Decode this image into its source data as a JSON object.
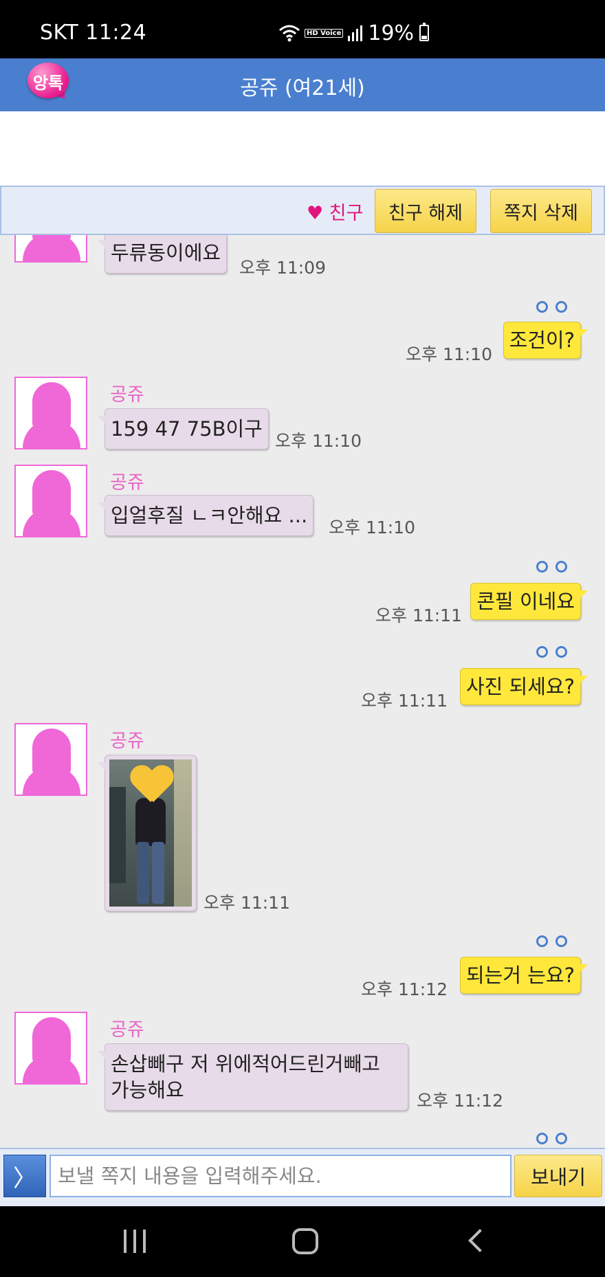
{
  "status_bar": {
    "carrier_time": "SKT 11:24",
    "hd_voice": "HD Voice",
    "battery": "19%"
  },
  "header": {
    "logo_text": "앙톡",
    "title": "공쥬 (여21세)"
  },
  "friend_bar": {
    "status_label": "♥ 친구",
    "unfriend_label": "친구 해제",
    "delete_label": "쪽지 삭제"
  },
  "messages": [
    {
      "type": "in",
      "text": "두류동이에요",
      "time": "오후 11:09"
    },
    {
      "type": "out",
      "text": "조건이?",
      "time": "오후 11:10",
      "read_mark": "oo"
    },
    {
      "type": "in",
      "name": "공쥬",
      "text": "159 47 75B이구",
      "time": "오후 11:10"
    },
    {
      "type": "in",
      "name": "공쥬",
      "text": "입얼후질 ㄴㅋ안해요 ...",
      "time": "오후 11:10"
    },
    {
      "type": "out",
      "text": "콘필 이네요",
      "time": "오후 11:11",
      "read_mark": "oo"
    },
    {
      "type": "out",
      "text": "사진 되세요?",
      "time": "오후 11:11",
      "read_mark": "oo"
    },
    {
      "type": "in-photo",
      "name": "공쥬",
      "time": "오후 11:11"
    },
    {
      "type": "out",
      "text": "되는거 는요?",
      "time": "오후 11:12",
      "read_mark": "oo"
    },
    {
      "type": "in",
      "name": "공쥬",
      "text_line1": "손삽빼구 저 위에적어드린거빼고",
      "text_line2": "가능해요",
      "time": "오후 11:12"
    }
  ],
  "input_bar": {
    "expand_icon": "〉",
    "placeholder": "보낼 쪽지 내용을 입력해주세요.",
    "send_label": "보내기"
  },
  "colors": {
    "header_blue": "#4a7fcf",
    "incoming_bubble": "#e8dbe9",
    "outgoing_bubble": "#ffe83b",
    "name_pink": "#e965c6",
    "friend_pink": "#e0147f"
  }
}
